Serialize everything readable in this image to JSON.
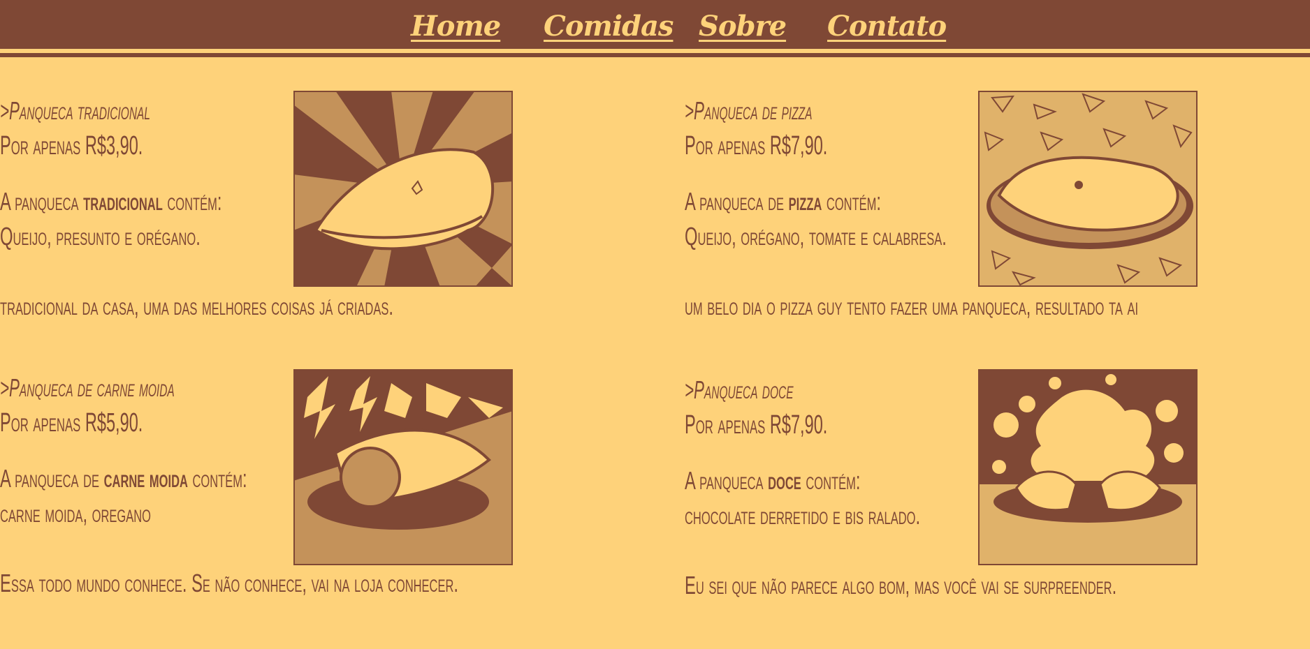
{
  "nav": {
    "links": [
      "Home",
      "Comidas",
      "Sobre",
      "Contato"
    ]
  },
  "items": [
    {
      "title": ">Panqueca tradicional",
      "price": "Por apenas R$3,90.",
      "contains_prefix": "A panqueca ",
      "contains_bold": "tradicional",
      "contains_suffix": " contém:",
      "ingredients": "Queijo, presunto e orégano.",
      "description": "tradicional da casa, uma das melhores coisas já criadas."
    },
    {
      "title": ">Panqueca de pizza",
      "price": "Por apenas R$7,90.",
      "contains_prefix": "A panqueca de ",
      "contains_bold": "pizza",
      "contains_suffix": " contém:",
      "ingredients": "Queijo, orégano, tomate e calabresa.",
      "description": "um belo dia o pizza guy tento fazer uma panqueca, resultado ta ai"
    },
    {
      "title": ">Panqueca de carne moida",
      "price": "Por apenas R$5,90.",
      "contains_prefix": "A panqueca de ",
      "contains_bold": "carne moida",
      "contains_suffix": " contém:",
      "ingredients": "carne moida, oregano",
      "description": "Essa todo mundo conhece. Se não conhece, vai na loja conhecer."
    },
    {
      "title": ">Panqueca doce",
      "price": "Por apenas R$7,90.",
      "contains_prefix": "A panqueca ",
      "contains_bold": "doce",
      "contains_suffix": " contém:",
      "ingredients": "chocolate derretido e bis ralado.",
      "description": "Eu sei que não parece algo bom, mas você vai se surpreender."
    }
  ],
  "colors": {
    "background": "#fed27a",
    "brown": "#7f4835",
    "tan": "#c4925a"
  }
}
